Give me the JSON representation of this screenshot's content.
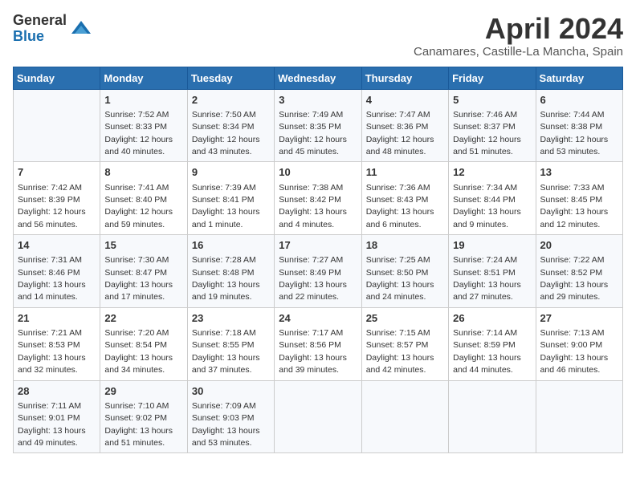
{
  "header": {
    "logo_general": "General",
    "logo_blue": "Blue",
    "month_title": "April 2024",
    "location": "Canamares, Castille-La Mancha, Spain"
  },
  "columns": [
    "Sunday",
    "Monday",
    "Tuesday",
    "Wednesday",
    "Thursday",
    "Friday",
    "Saturday"
  ],
  "weeks": [
    [
      {
        "day": "",
        "sunrise": "",
        "sunset": "",
        "daylight": ""
      },
      {
        "day": "1",
        "sunrise": "7:52 AM",
        "sunset": "8:33 PM",
        "daylight": "12 hours and 40 minutes."
      },
      {
        "day": "2",
        "sunrise": "7:50 AM",
        "sunset": "8:34 PM",
        "daylight": "12 hours and 43 minutes."
      },
      {
        "day": "3",
        "sunrise": "7:49 AM",
        "sunset": "8:35 PM",
        "daylight": "12 hours and 45 minutes."
      },
      {
        "day": "4",
        "sunrise": "7:47 AM",
        "sunset": "8:36 PM",
        "daylight": "12 hours and 48 minutes."
      },
      {
        "day": "5",
        "sunrise": "7:46 AM",
        "sunset": "8:37 PM",
        "daylight": "12 hours and 51 minutes."
      },
      {
        "day": "6",
        "sunrise": "7:44 AM",
        "sunset": "8:38 PM",
        "daylight": "12 hours and 53 minutes."
      }
    ],
    [
      {
        "day": "7",
        "sunrise": "7:42 AM",
        "sunset": "8:39 PM",
        "daylight": "12 hours and 56 minutes."
      },
      {
        "day": "8",
        "sunrise": "7:41 AM",
        "sunset": "8:40 PM",
        "daylight": "12 hours and 59 minutes."
      },
      {
        "day": "9",
        "sunrise": "7:39 AM",
        "sunset": "8:41 PM",
        "daylight": "13 hours and 1 minute."
      },
      {
        "day": "10",
        "sunrise": "7:38 AM",
        "sunset": "8:42 PM",
        "daylight": "13 hours and 4 minutes."
      },
      {
        "day": "11",
        "sunrise": "7:36 AM",
        "sunset": "8:43 PM",
        "daylight": "13 hours and 6 minutes."
      },
      {
        "day": "12",
        "sunrise": "7:34 AM",
        "sunset": "8:44 PM",
        "daylight": "13 hours and 9 minutes."
      },
      {
        "day": "13",
        "sunrise": "7:33 AM",
        "sunset": "8:45 PM",
        "daylight": "13 hours and 12 minutes."
      }
    ],
    [
      {
        "day": "14",
        "sunrise": "7:31 AM",
        "sunset": "8:46 PM",
        "daylight": "13 hours and 14 minutes."
      },
      {
        "day": "15",
        "sunrise": "7:30 AM",
        "sunset": "8:47 PM",
        "daylight": "13 hours and 17 minutes."
      },
      {
        "day": "16",
        "sunrise": "7:28 AM",
        "sunset": "8:48 PM",
        "daylight": "13 hours and 19 minutes."
      },
      {
        "day": "17",
        "sunrise": "7:27 AM",
        "sunset": "8:49 PM",
        "daylight": "13 hours and 22 minutes."
      },
      {
        "day": "18",
        "sunrise": "7:25 AM",
        "sunset": "8:50 PM",
        "daylight": "13 hours and 24 minutes."
      },
      {
        "day": "19",
        "sunrise": "7:24 AM",
        "sunset": "8:51 PM",
        "daylight": "13 hours and 27 minutes."
      },
      {
        "day": "20",
        "sunrise": "7:22 AM",
        "sunset": "8:52 PM",
        "daylight": "13 hours and 29 minutes."
      }
    ],
    [
      {
        "day": "21",
        "sunrise": "7:21 AM",
        "sunset": "8:53 PM",
        "daylight": "13 hours and 32 minutes."
      },
      {
        "day": "22",
        "sunrise": "7:20 AM",
        "sunset": "8:54 PM",
        "daylight": "13 hours and 34 minutes."
      },
      {
        "day": "23",
        "sunrise": "7:18 AM",
        "sunset": "8:55 PM",
        "daylight": "13 hours and 37 minutes."
      },
      {
        "day": "24",
        "sunrise": "7:17 AM",
        "sunset": "8:56 PM",
        "daylight": "13 hours and 39 minutes."
      },
      {
        "day": "25",
        "sunrise": "7:15 AM",
        "sunset": "8:57 PM",
        "daylight": "13 hours and 42 minutes."
      },
      {
        "day": "26",
        "sunrise": "7:14 AM",
        "sunset": "8:59 PM",
        "daylight": "13 hours and 44 minutes."
      },
      {
        "day": "27",
        "sunrise": "7:13 AM",
        "sunset": "9:00 PM",
        "daylight": "13 hours and 46 minutes."
      }
    ],
    [
      {
        "day": "28",
        "sunrise": "7:11 AM",
        "sunset": "9:01 PM",
        "daylight": "13 hours and 49 minutes."
      },
      {
        "day": "29",
        "sunrise": "7:10 AM",
        "sunset": "9:02 PM",
        "daylight": "13 hours and 51 minutes."
      },
      {
        "day": "30",
        "sunrise": "7:09 AM",
        "sunset": "9:03 PM",
        "daylight": "13 hours and 53 minutes."
      },
      {
        "day": "",
        "sunrise": "",
        "sunset": "",
        "daylight": ""
      },
      {
        "day": "",
        "sunrise": "",
        "sunset": "",
        "daylight": ""
      },
      {
        "day": "",
        "sunrise": "",
        "sunset": "",
        "daylight": ""
      },
      {
        "day": "",
        "sunrise": "",
        "sunset": "",
        "daylight": ""
      }
    ]
  ]
}
